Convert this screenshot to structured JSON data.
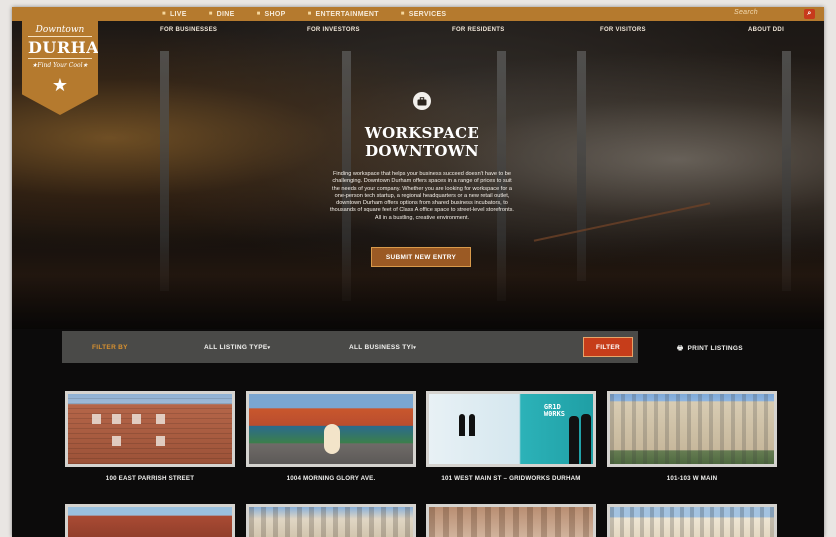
{
  "topnav": {
    "items": [
      "LIVE",
      "DINE",
      "SHOP",
      "ENTERTAINMENT",
      "SERVICES"
    ],
    "search_placeholder": "Search"
  },
  "subnav": {
    "items": [
      "FOR BUSINESSES",
      "FOR INVESTORS",
      "FOR RESIDENTS",
      "FOR VISITORS",
      "ABOUT DDI"
    ]
  },
  "logo": {
    "line1": "Downtown",
    "line2": "DURHAM",
    "line3": "★Find Your Cool★"
  },
  "hero": {
    "icon": "briefcase-icon",
    "title_line1": "WORKSPACE",
    "title_line2": "DOWNTOWN",
    "description": "Finding workspace that helps your business succeed doesn't have to be challenging. Downtown Durham offers spaces in a range of prices to suit the needs of your company. Whether you are looking for workspace for a one-person tech startup, a regional headquarters or a new retail outlet, downtown Durham offers options from shared business incubators, to thousands of square feet of Class A office space to street-level storefronts. All in a bustling, creative environment.",
    "submit_label": "SUBMIT NEW ENTRY"
  },
  "filter": {
    "label": "FILTER BY",
    "listing_type": "ALL LISTING TYPE",
    "business_type": "ALL BUSINESS TYI",
    "button": "FILTER",
    "print_label": "PRINT LISTINGS"
  },
  "listings": [
    {
      "title": "100 EAST PARRISH STREET"
    },
    {
      "title": "1004 MORNING GLORY AVE."
    },
    {
      "title": "101 WEST MAIN ST – GRIDWORKS DURHAM"
    },
    {
      "title": "101-103 W MAIN"
    }
  ],
  "gridworks_sign": [
    "GR1D",
    "W0RKS"
  ],
  "colors": {
    "brand_gold": "#b57a2e",
    "filter_red": "#c63d1a",
    "filter_bar": "#4a4a48",
    "background": "#0c0b0b"
  }
}
